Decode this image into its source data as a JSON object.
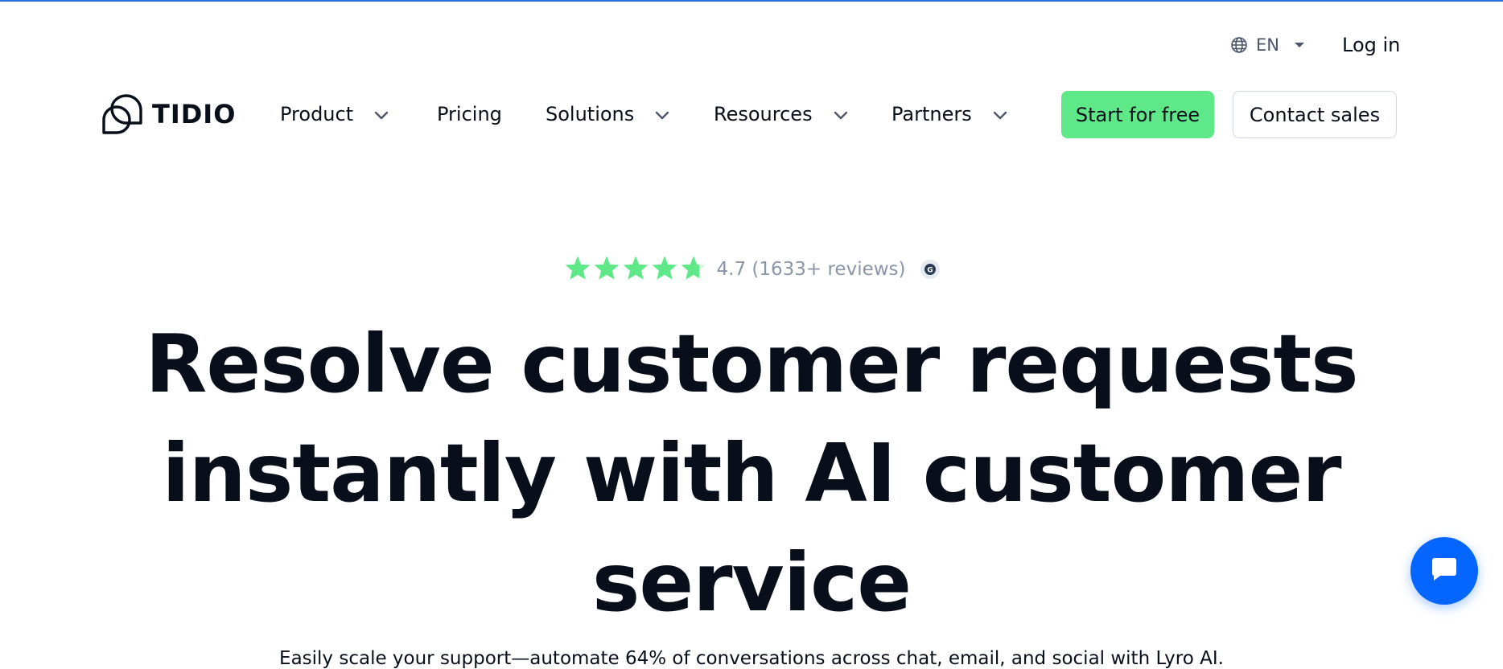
{
  "colors": {
    "accent_green": "#5ee887",
    "chat_blue": "#0566ff",
    "star_green": "#5ee887",
    "text_dark": "#080f1a",
    "text_muted": "#8b95a8"
  },
  "utility": {
    "language": "EN",
    "login_label": "Log in"
  },
  "brand": {
    "name": "TIDIO"
  },
  "nav": {
    "items": [
      {
        "label": "Product",
        "has_dropdown": true
      },
      {
        "label": "Pricing",
        "has_dropdown": false
      },
      {
        "label": "Solutions",
        "has_dropdown": true
      },
      {
        "label": "Resources",
        "has_dropdown": true
      },
      {
        "label": "Partners",
        "has_dropdown": true
      }
    ],
    "cta_primary": "Start for free",
    "cta_secondary": "Contact sales"
  },
  "rating": {
    "stars": 4.7,
    "max_stars": 5,
    "text": "4.7 (1633+ reviews)",
    "badge_icon": "g2-icon"
  },
  "hero": {
    "title_line1": "Resolve customer requests",
    "title_line2": "instantly with AI customer",
    "title_line3": "service",
    "subtitle": "Easily scale your support—automate 64% of conversations across chat, email, and social with Lyro AI."
  },
  "chat_widget": {
    "icon": "chat-bubble-icon"
  }
}
